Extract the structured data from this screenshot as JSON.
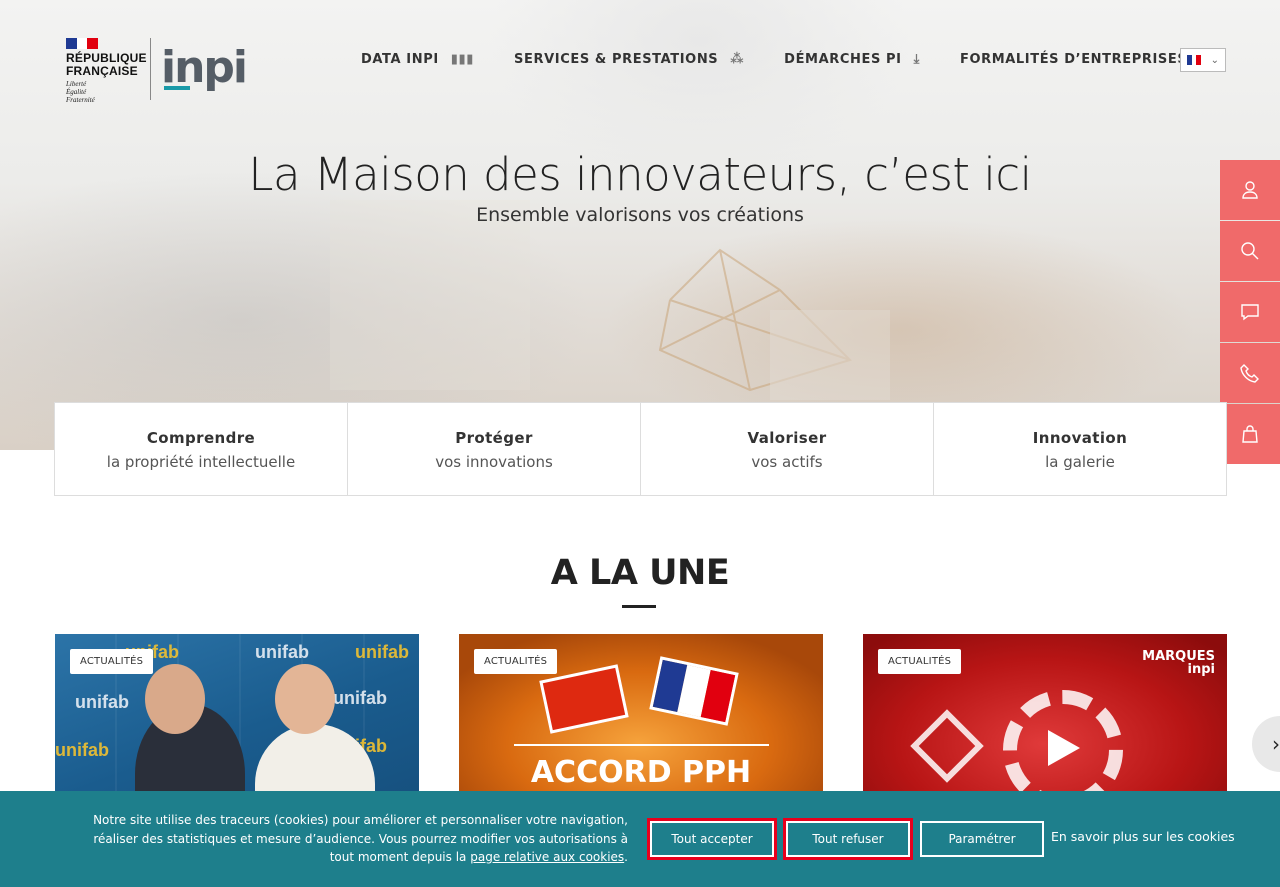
{
  "header": {
    "gov_name_line1": "RÉPUBLIQUE",
    "gov_name_line2": "FRANÇAISE",
    "gov_motto_1": "Liberté",
    "gov_motto_2": "Égalité",
    "gov_motto_3": "Fraternité",
    "brand": "inpi",
    "nav": [
      {
        "label": "DATA INPI",
        "icon": "data-icon"
      },
      {
        "label": "SERVICES & PRESTATIONS",
        "icon": "network-icon"
      },
      {
        "label": "DÉMARCHES PI",
        "icon": "download-icon"
      },
      {
        "label": "FORMALITÉS D’ENTREPRISES",
        "icon": "e-badge-icon"
      }
    ],
    "lang_icon": "flag-fr-icon"
  },
  "hero": {
    "title": "La Maison des innovateurs, c’est ici",
    "subtitle": "Ensemble valorisons vos créations"
  },
  "side_actions": [
    "user-icon",
    "search-icon",
    "chat-icon",
    "phone-icon",
    "bag-icon"
  ],
  "pillars": [
    {
      "title": "Comprendre",
      "sub": "la propriété intellectuelle"
    },
    {
      "title": "Protéger",
      "sub": "vos innovations"
    },
    {
      "title": "Valoriser",
      "sub": "vos actifs"
    },
    {
      "title": "Innovation",
      "sub": "la galerie"
    }
  ],
  "une": {
    "title": "A LA UNE",
    "cards": [
      {
        "tag": "ACTUALITÉS",
        "logo_text": "unifab"
      },
      {
        "tag": "ACTUALITÉS",
        "headline": "ACCORD PPH"
      },
      {
        "tag": "ACTUALITÉS",
        "brand_line1": "MARQUES",
        "brand_line2": "inpi"
      }
    ]
  },
  "cookie": {
    "text": "Notre site utilise des traceurs (cookies) pour améliorer et personnaliser votre navigation, réaliser des statistiques et mesure d’audience. Vous pourrez modifier vos autorisations à tout moment depuis la",
    "link": "page relative aux cookies",
    "period": ".",
    "accept": "Tout accepter",
    "refuse": "Tout refuser",
    "settings": "Paramétrer",
    "more": "En savoir plus sur les cookies"
  },
  "colors": {
    "accent": "#f06a6a",
    "cookie_bg": "#1e7f8c",
    "highlight": "#e8001c",
    "brand_teal": "#1a9aa8"
  }
}
